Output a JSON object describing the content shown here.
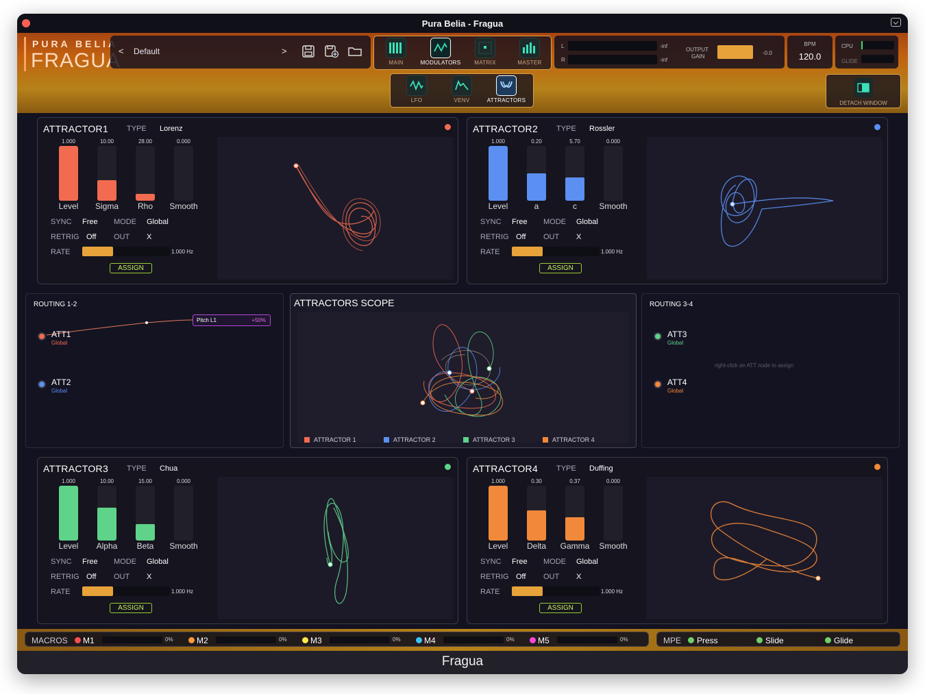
{
  "window": {
    "title": "Pura Belia - Fragua"
  },
  "logo": {
    "top": "PURA BELIA",
    "main": "FRAGUA"
  },
  "preset": {
    "prev": "<",
    "name": "Default",
    "next": ">"
  },
  "tabs_top": [
    {
      "label": "MAIN",
      "icon": "bars-icon"
    },
    {
      "label": "MODULATORS",
      "icon": "wave-icon"
    },
    {
      "label": "MATRIX",
      "icon": "matrix-icon"
    },
    {
      "label": "MASTER",
      "icon": "meter-icon"
    }
  ],
  "tabs_mod": [
    {
      "label": "LFO",
      "icon": "lfo-icon"
    },
    {
      "label": "VENV",
      "icon": "envelope-icon"
    },
    {
      "label": "ATTRACTORS",
      "icon": "attractor-icon"
    }
  ],
  "output": {
    "l": "L",
    "r": "R",
    "l_val": "-inf",
    "r_val": "-inf",
    "label1": "OUTPUT",
    "label2": "GAIN",
    "gain": "-0.0"
  },
  "bpm": {
    "label": "BPM",
    "value": "120.0"
  },
  "cpu": {
    "label": "CPU",
    "glide": "GLIDE"
  },
  "detach": {
    "label": "DETACH WINDOW"
  },
  "params": {
    "type": "TYPE",
    "sync": "SYNC",
    "mode": "MODE",
    "retrig": "RETRIG",
    "out": "OUT",
    "rate": "RATE",
    "assign": "ASSIGN"
  },
  "attractors": [
    {
      "title": "ATTRACTOR1",
      "type": "Lorenz",
      "color": "#f26b50",
      "sliders": [
        {
          "label": "Level",
          "value": "1.000",
          "fill": 1.0
        },
        {
          "label": "Sigma",
          "value": "10.00",
          "fill": 0.38
        },
        {
          "label": "Rho",
          "value": "28.00",
          "fill": 0.13
        },
        {
          "label": "Smooth",
          "value": "0.000",
          "fill": 0
        }
      ],
      "sync": "Free",
      "mode": "Global",
      "retrig": "Off",
      "out": "X",
      "rate": "1.000 Hz"
    },
    {
      "title": "ATTRACTOR2",
      "type": "Rossler",
      "color": "#5b8ff2",
      "sliders": [
        {
          "label": "Level",
          "value": "1.000",
          "fill": 1.0
        },
        {
          "label": "a",
          "value": "0.20",
          "fill": 0.5
        },
        {
          "label": "c",
          "value": "5.70",
          "fill": 0.42
        },
        {
          "label": "Smooth",
          "value": "0.000",
          "fill": 0
        }
      ],
      "sync": "Free",
      "mode": "Global",
      "retrig": "Off",
      "out": "X",
      "rate": "1.000 Hz"
    },
    {
      "title": "ATTRACTOR3",
      "type": "Chua",
      "color": "#5fd38a",
      "sliders": [
        {
          "label": "Level",
          "value": "1.000",
          "fill": 1.0
        },
        {
          "label": "Alpha",
          "value": "10.00",
          "fill": 0.6
        },
        {
          "label": "Beta",
          "value": "15.00",
          "fill": 0.3
        },
        {
          "label": "Smooth",
          "value": "0.000",
          "fill": 0
        }
      ],
      "sync": "Free",
      "mode": "Global",
      "retrig": "Off",
      "out": "X",
      "rate": "1.000 Hz"
    },
    {
      "title": "ATTRACTOR4",
      "type": "Duffing",
      "color": "#f2893a",
      "sliders": [
        {
          "label": "Level",
          "value": "1.000",
          "fill": 1.0
        },
        {
          "label": "Delta",
          "value": "0.30",
          "fill": 0.55
        },
        {
          "label": "Gamma",
          "value": "0.37",
          "fill": 0.42
        },
        {
          "label": "Smooth",
          "value": "0.000",
          "fill": 0
        }
      ],
      "sync": "Free",
      "mode": "Global",
      "retrig": "Off",
      "out": "X",
      "rate": "1.000 Hz"
    }
  ],
  "routing12": {
    "title": "ROUTING 1-2",
    "nodes": [
      {
        "name": "ATT1",
        "sub": "Global",
        "color": "#f26b50"
      },
      {
        "name": "ATT2",
        "sub": "Global",
        "color": "#5b8ff2"
      }
    ],
    "target": {
      "name": "Pitch L1",
      "amount": "+50%"
    }
  },
  "routing34": {
    "title": "ROUTING 3-4",
    "hint": "right-click an ATT node to assign",
    "nodes": [
      {
        "name": "ATT3",
        "sub": "Global",
        "color": "#5fd38a"
      },
      {
        "name": "ATT4",
        "sub": "Global",
        "color": "#f2893a"
      }
    ]
  },
  "scope": {
    "title": "ATTRACTORS SCOPE",
    "legend": [
      {
        "label": "ATTRACTOR 1",
        "color": "#f26b50"
      },
      {
        "label": "ATTRACTOR 2",
        "color": "#5b8ff2"
      },
      {
        "label": "ATTRACTOR 3",
        "color": "#5fd38a"
      },
      {
        "label": "ATTRACTOR 4",
        "color": "#f2893a"
      }
    ]
  },
  "macros": {
    "label": "MACROS",
    "items": [
      {
        "name": "M1",
        "value": "0%",
        "color": "#ff4e4e"
      },
      {
        "name": "M2",
        "value": "0%",
        "color": "#ff9a3c"
      },
      {
        "name": "M3",
        "value": "0%",
        "color": "#ffe84a"
      },
      {
        "name": "M4",
        "value": "0%",
        "color": "#3cc3ff"
      },
      {
        "name": "M5",
        "value": "0%",
        "color": "#ff46e0"
      }
    ]
  },
  "mpe": {
    "label": "MPE",
    "items": [
      {
        "name": "Press",
        "color": "#6fd06a"
      },
      {
        "name": "Slide",
        "color": "#6fd06a"
      },
      {
        "name": "Glide",
        "color": "#6fd06a"
      }
    ]
  },
  "footer": {
    "title": "Fragua"
  }
}
